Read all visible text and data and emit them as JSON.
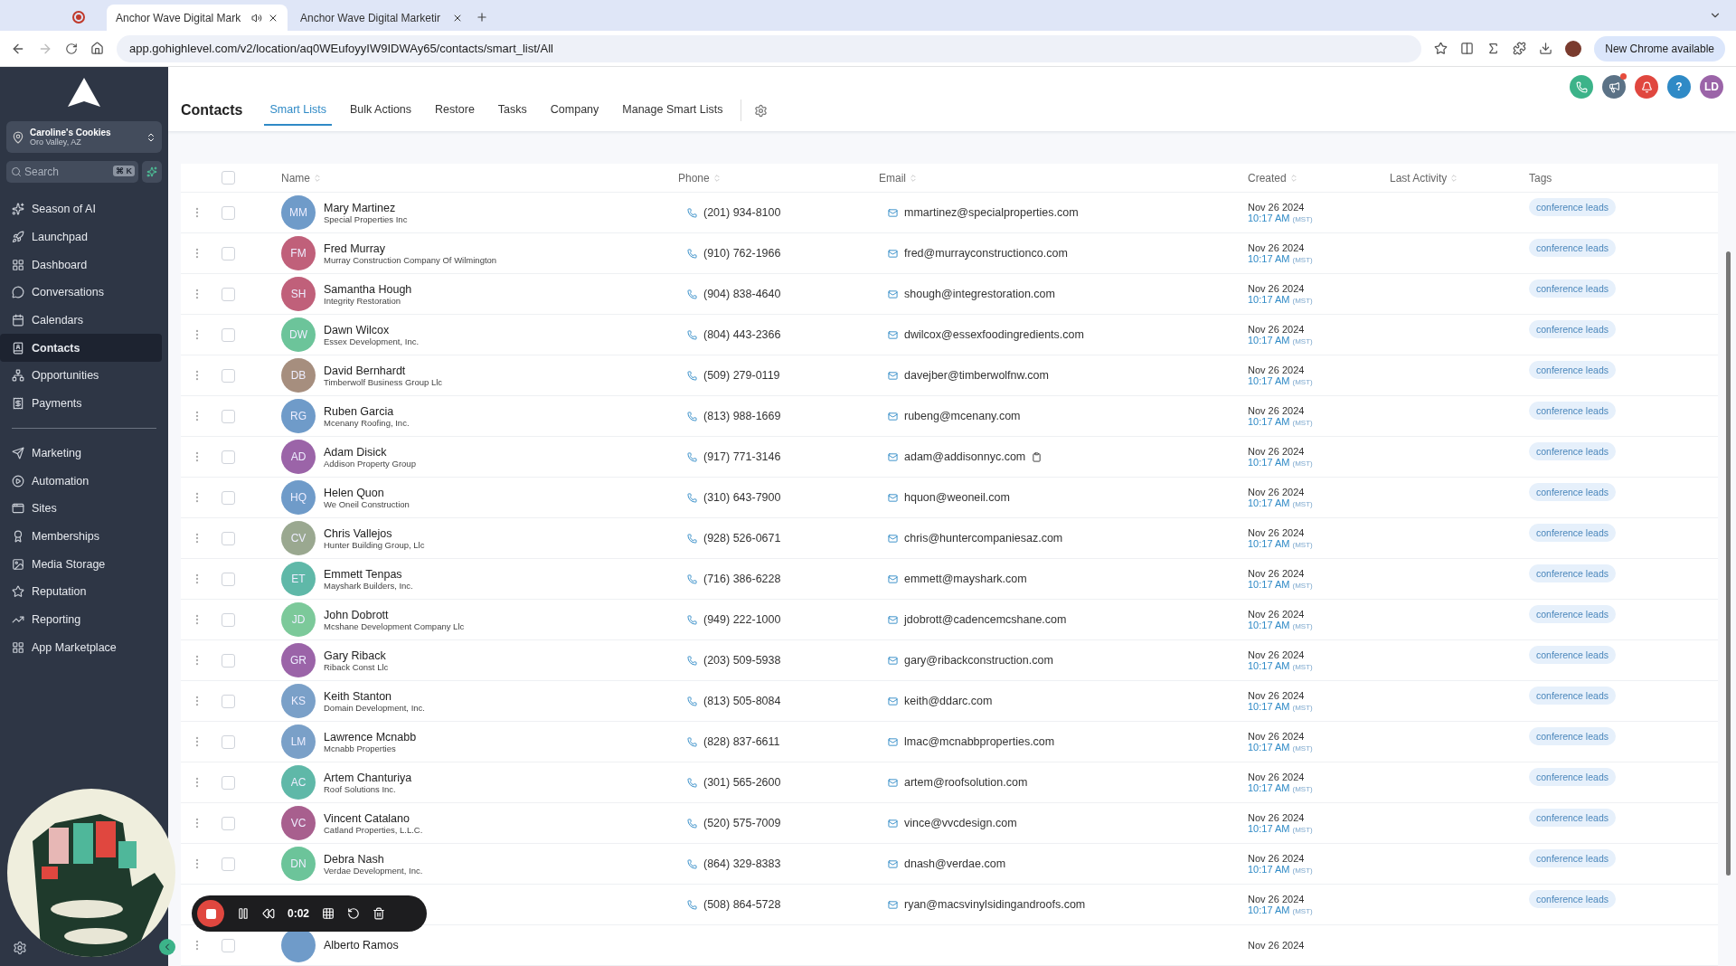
{
  "browser": {
    "tabs": [
      {
        "title": "Anchor Wave Digital Mark",
        "selected": true
      },
      {
        "title": "Anchor Wave Digital Marketir",
        "selected": false
      }
    ],
    "url": "app.gohighlevel.com/v2/location/aq0WEufoyyIW9IDWAy65/contacts/smart_list/All",
    "update_button": "New Chrome available"
  },
  "sidebar": {
    "location": {
      "name": "Caroline's Cookies",
      "place": "Oro Valley, AZ"
    },
    "search": {
      "placeholder": "Search",
      "shortcut": "⌘ K"
    },
    "nav_groups": [
      [
        {
          "label": "Season of AI",
          "selected": false
        },
        {
          "label": "Launchpad",
          "selected": false
        },
        {
          "label": "Dashboard",
          "selected": false
        },
        {
          "label": "Conversations",
          "selected": false
        },
        {
          "label": "Calendars",
          "selected": false
        },
        {
          "label": "Contacts",
          "selected": true
        },
        {
          "label": "Opportunities",
          "selected": false
        },
        {
          "label": "Payments",
          "selected": false
        }
      ],
      [
        {
          "label": "Marketing",
          "selected": false
        },
        {
          "label": "Automation",
          "selected": false
        },
        {
          "label": "Sites",
          "selected": false
        },
        {
          "label": "Memberships",
          "selected": false
        },
        {
          "label": "Media Storage",
          "selected": false
        },
        {
          "label": "Reputation",
          "selected": false
        },
        {
          "label": "Reporting",
          "selected": false
        },
        {
          "label": "App Marketplace",
          "selected": false
        }
      ]
    ]
  },
  "header": {
    "title": "Contacts",
    "tabs": [
      {
        "label": "Smart Lists",
        "selected": true
      },
      {
        "label": "Bulk Actions",
        "selected": false
      },
      {
        "label": "Restore",
        "selected": false
      },
      {
        "label": "Tasks",
        "selected": false
      },
      {
        "label": "Company",
        "selected": false
      },
      {
        "label": "Manage Smart Lists",
        "selected": false
      }
    ],
    "help_label": "?",
    "user_initials": "LD"
  },
  "table": {
    "select_all_checked": false,
    "columns": [
      "Name",
      "Phone",
      "Email",
      "Created",
      "Last Activity",
      "Tags"
    ],
    "rows": [
      {
        "initials": "MM",
        "color": "#6f9bc9",
        "name": "Mary Martinez",
        "checked": false,
        "company": "Special Properties Inc",
        "phone": "(201) 934-8100",
        "email": "mmartinez@specialproperties.com",
        "copy_icon": false,
        "date": "Nov 26 2024",
        "time": "10:17 AM",
        "zone": "(MST)",
        "tag": "conference leads"
      },
      {
        "initials": "FM",
        "color": "#c0607a",
        "name": "Fred Murray",
        "checked": false,
        "company": "Murray Construction Company Of Wilmington",
        "phone": "(910) 762-1966",
        "email": "fred@murrayconstructionco.com",
        "copy_icon": false,
        "date": "Nov 26 2024",
        "time": "10:17 AM",
        "zone": "(MST)",
        "tag": "conference leads"
      },
      {
        "initials": "SH",
        "color": "#c0607a",
        "name": "Samantha Hough",
        "checked": false,
        "company": "Integrity Restoration",
        "phone": "(904) 838-4640",
        "email": "shough@integrestoration.com",
        "copy_icon": false,
        "date": "Nov 26 2024",
        "time": "10:17 AM",
        "zone": "(MST)",
        "tag": "conference leads"
      },
      {
        "initials": "DW",
        "color": "#6cc49a",
        "name": "Dawn Wilcox",
        "checked": false,
        "company": "Essex Development, Inc.",
        "phone": "(804) 443-2366",
        "email": "dwilcox@essexfoodingredients.com",
        "copy_icon": false,
        "date": "Nov 26 2024",
        "time": "10:17 AM",
        "zone": "(MST)",
        "tag": "conference leads"
      },
      {
        "initials": "DB",
        "color": "#a68e7e",
        "name": "David Bernhardt",
        "checked": false,
        "company": "Timberwolf Business Group Llc",
        "phone": "(509) 279-0119",
        "email": "davejber@timberwolfnw.com",
        "copy_icon": false,
        "date": "Nov 26 2024",
        "time": "10:17 AM",
        "zone": "(MST)",
        "tag": "conference leads"
      },
      {
        "initials": "RG",
        "color": "#6f9bc9",
        "name": "Ruben Garcia",
        "checked": false,
        "company": "Mcenany Roofing, Inc.",
        "phone": "(813) 988-1669",
        "email": "rubeng@mcenany.com",
        "copy_icon": false,
        "date": "Nov 26 2024",
        "time": "10:17 AM",
        "zone": "(MST)",
        "tag": "conference leads"
      },
      {
        "initials": "AD",
        "color": "#9b64a8",
        "name": "Adam Disick",
        "checked": false,
        "company": "Addison Property Group",
        "phone": "(917) 771-3146",
        "email": "adam@addisonnyc.com",
        "copy_icon": true,
        "date": "Nov 26 2024",
        "time": "10:17 AM",
        "zone": "(MST)",
        "tag": "conference leads"
      },
      {
        "initials": "HQ",
        "color": "#6f9bc9",
        "name": "Helen Quon",
        "checked": false,
        "company": "We Oneil Construction",
        "phone": "(310) 643-7900",
        "email": "hquon@weoneil.com",
        "copy_icon": false,
        "date": "Nov 26 2024",
        "time": "10:17 AM",
        "zone": "(MST)",
        "tag": "conference leads"
      },
      {
        "initials": "CV",
        "color": "#9aa890",
        "name": "Chris Vallejos",
        "checked": false,
        "company": "Hunter Building Group, Llc",
        "phone": "(928) 526-0671",
        "email": "chris@huntercompaniesaz.com",
        "copy_icon": false,
        "date": "Nov 26 2024",
        "time": "10:17 AM",
        "zone": "(MST)",
        "tag": "conference leads"
      },
      {
        "initials": "ET",
        "color": "#5fb8a8",
        "name": "Emmett Tenpas",
        "checked": false,
        "company": "Mayshark Builders, Inc.",
        "phone": "(716) 386-6228",
        "email": "emmett@mayshark.com",
        "copy_icon": false,
        "date": "Nov 26 2024",
        "time": "10:17 AM",
        "zone": "(MST)",
        "tag": "conference leads"
      },
      {
        "initials": "JD",
        "color": "#7cc99a",
        "name": "John Dobrott",
        "checked": false,
        "company": "Mcshane Development Company Llc",
        "phone": "(949) 222-1000",
        "email": "jdobrott@cadencemcshane.com",
        "copy_icon": false,
        "date": "Nov 26 2024",
        "time": "10:17 AM",
        "zone": "(MST)",
        "tag": "conference leads"
      },
      {
        "initials": "GR",
        "color": "#9b64a8",
        "name": "Gary Riback",
        "checked": false,
        "company": "Riback Const Llc",
        "phone": "(203) 509-5938",
        "email": "gary@ribackconstruction.com",
        "copy_icon": false,
        "date": "Nov 26 2024",
        "time": "10:17 AM",
        "zone": "(MST)",
        "tag": "conference leads"
      },
      {
        "initials": "KS",
        "color": "#7aa0c8",
        "name": "Keith Stanton",
        "checked": false,
        "company": "Domain Development, Inc.",
        "phone": "(813) 505-8084",
        "email": "keith@ddarc.com",
        "copy_icon": false,
        "date": "Nov 26 2024",
        "time": "10:17 AM",
        "zone": "(MST)",
        "tag": "conference leads"
      },
      {
        "initials": "LM",
        "color": "#7aa0c8",
        "name": "Lawrence Mcnabb",
        "checked": false,
        "company": "Mcnabb Properties",
        "phone": "(828) 837-6611",
        "email": "lmac@mcnabbproperties.com",
        "copy_icon": false,
        "date": "Nov 26 2024",
        "time": "10:17 AM",
        "zone": "(MST)",
        "tag": "conference leads"
      },
      {
        "initials": "AC",
        "color": "#5fb8a8",
        "name": "Artem Chanturiya",
        "checked": false,
        "company": "Roof Solutions Inc.",
        "phone": "(301) 565-2600",
        "email": "artem@roofsolution.com",
        "copy_icon": false,
        "date": "Nov 26 2024",
        "time": "10:17 AM",
        "zone": "(MST)",
        "tag": "conference leads"
      },
      {
        "initials": "VC",
        "color": "#a85f8e",
        "name": "Vincent Catalano",
        "checked": false,
        "company": "Catland Properties, L.L.C.",
        "phone": "(520) 575-7009",
        "email": "vince@vvcdesign.com",
        "copy_icon": false,
        "date": "Nov 26 2024",
        "time": "10:17 AM",
        "zone": "(MST)",
        "tag": "conference leads"
      },
      {
        "initials": "DN",
        "color": "#6cc49a",
        "name": "Debra Nash",
        "checked": false,
        "company": "Verdae Development, Inc.",
        "phone": "(864) 329-8383",
        "email": "dnash@verdae.com",
        "copy_icon": false,
        "date": "Nov 26 2024",
        "time": "10:17 AM",
        "zone": "(MST)",
        "tag": "conference leads"
      },
      {
        "phone": "(508) 864-5728",
        "email": "ryan@macsvinylsidingandroofs.com",
        "copy_icon": false,
        "date": "Nov 26 2024",
        "time": "10:17 AM",
        "zone": "(MST)",
        "tag": "conference leads"
      },
      {
        "name": "Alberto Ramos",
        "checked": false,
        "color": "#6f9bc9",
        "date": "Nov 26 2024"
      }
    ]
  },
  "recorder": {
    "time": "0:02"
  }
}
